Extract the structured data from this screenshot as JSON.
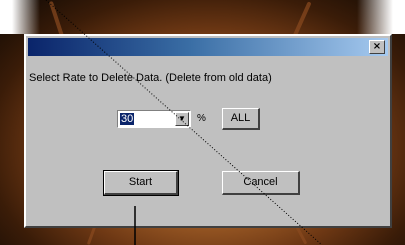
{
  "dialog": {
    "close_glyph": "×",
    "message": "Select Rate to Delete Data. (Delete from old data)",
    "rate_value": "30",
    "rate_unit": "%",
    "all_label": "ALL",
    "start_label": "Start",
    "cancel_label": "Cancel"
  },
  "icons": [
    "close-icon",
    "dropdown-arrow-icon"
  ],
  "colors": {
    "title_start": "#0a246a",
    "title_end": "#a6caf0",
    "face": "#c0c0c0",
    "background": "#8a4a1c"
  }
}
